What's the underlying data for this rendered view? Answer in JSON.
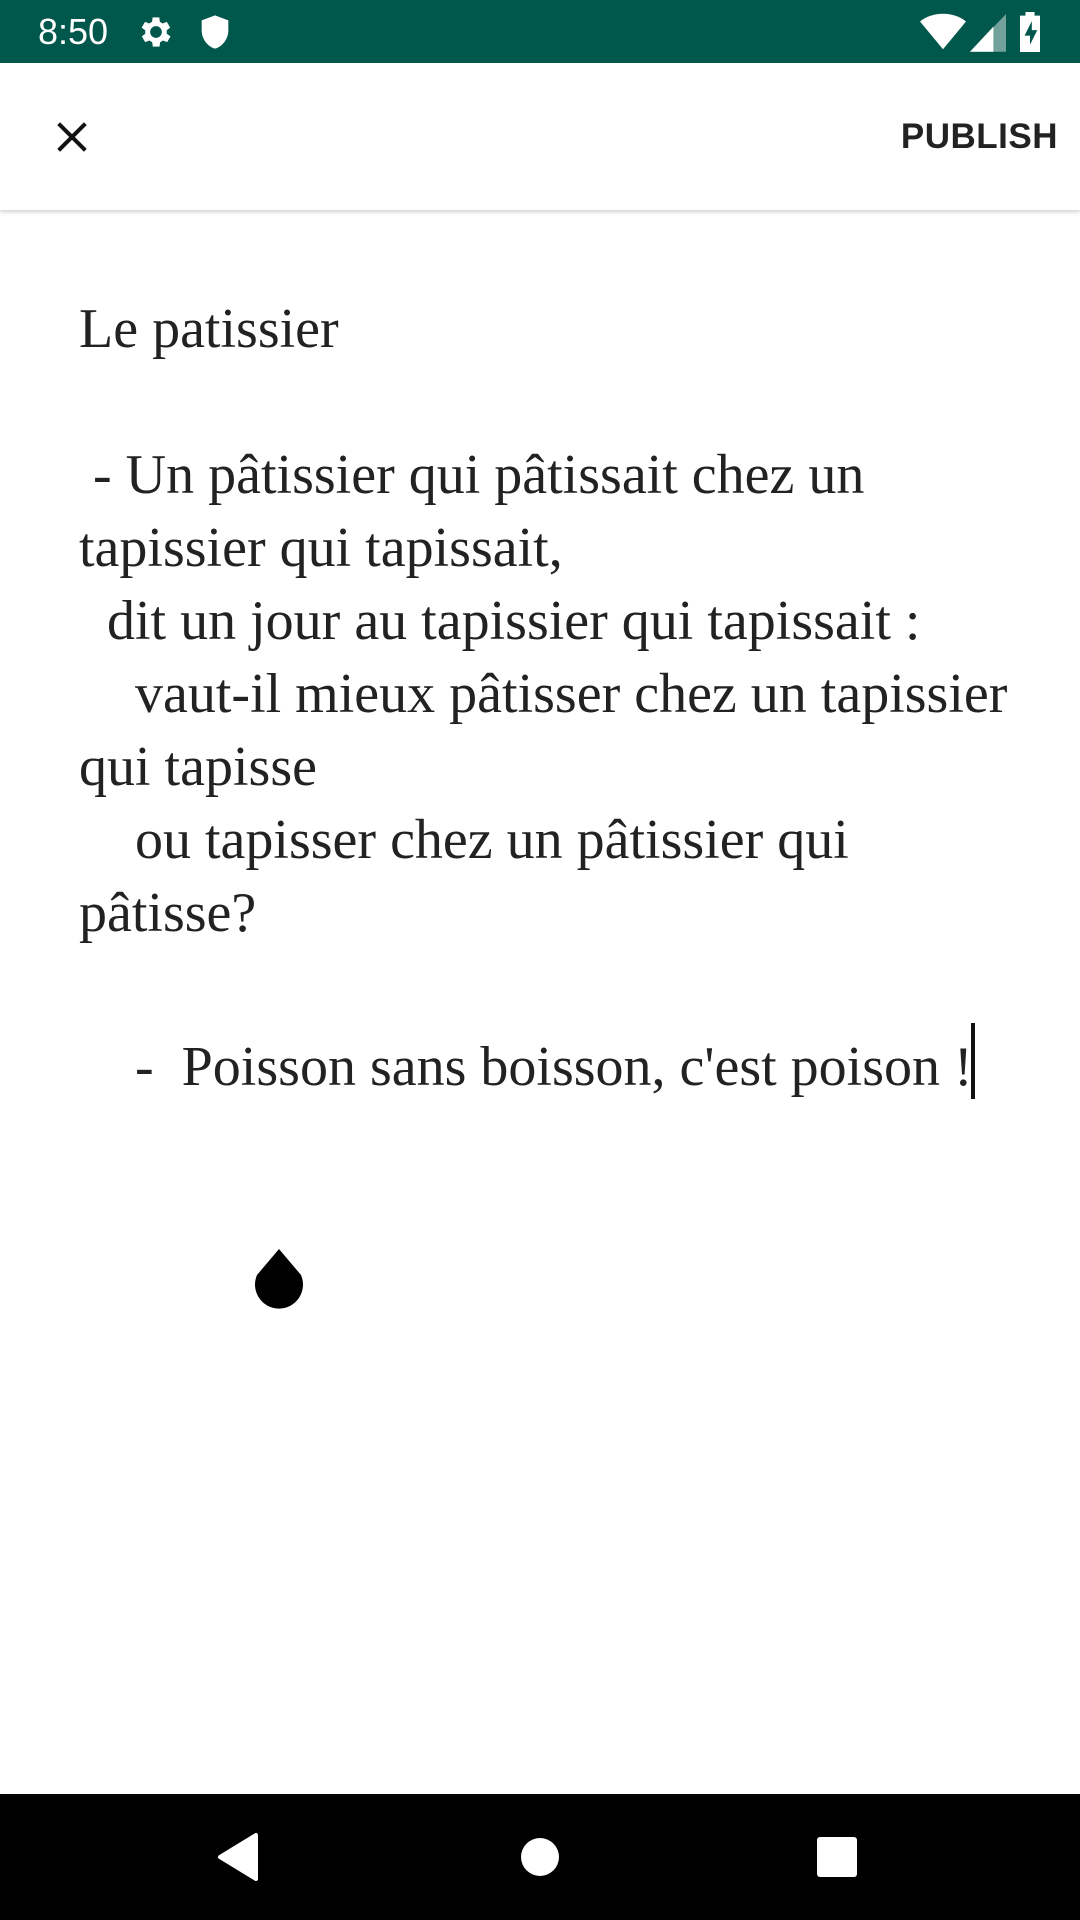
{
  "status_bar": {
    "time": "8:50",
    "background_color": "#00574b",
    "icons": [
      "gear-icon",
      "shield-icon",
      "wifi-icon",
      "cell-signal-icon",
      "battery-charging-icon"
    ]
  },
  "app_bar": {
    "close_icon": "close-icon",
    "publish_label": "PUBLISH"
  },
  "editor": {
    "title": "Le patissier",
    "body": "\n - Un pâtissier qui pâtissait chez un tapissier qui tapissait,\n  dit un jour au tapissier qui tapissait :\n    vaut-il mieux pâtisser chez un tapissier qui tapisse\n    ou tapisser chez un pâtissier qui pâtisse?\n\n    -  Poisson sans boisson, c'est poison !"
  },
  "nav_bar": {
    "back_icon": "back-triangle-icon",
    "home_icon": "home-circle-icon",
    "recents_icon": "recents-square-icon"
  }
}
